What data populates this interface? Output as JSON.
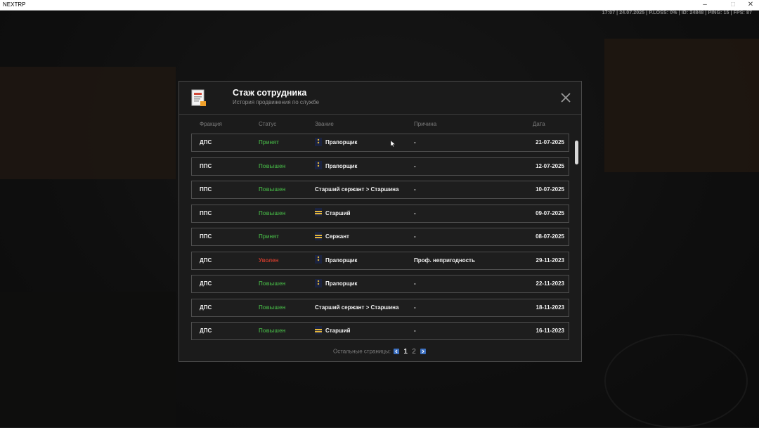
{
  "window": {
    "title": "NEXTRP"
  },
  "hud": {
    "stats": "17:07 | 24.07.2025 | P.LOSS: 0% | ID: 24848 | PING: 15 | FPS: 87"
  },
  "modal": {
    "title": "Стаж сотрудника",
    "subtitle": "История продвижения по службе",
    "columns": {
      "faction": "Фракция",
      "status": "Статус",
      "rank": "Звание",
      "reason": "Причина",
      "date": "Дата"
    },
    "rows": [
      {
        "faction": "ДПС",
        "status": "Принят",
        "rank": "Прапорщик",
        "rank_icon": "ensign-insignia-icon",
        "reason": "-",
        "date": "21-07-2025"
      },
      {
        "faction": "ППС",
        "status": "Повышен",
        "rank": "Прапорщик",
        "rank_icon": "ensign-insignia-icon",
        "reason": "-",
        "date": "12-07-2025"
      },
      {
        "faction": "ППС",
        "status": "Повышен",
        "rank": "Старший сержант > Старшина",
        "rank_icon": "",
        "reason": "-",
        "date": "10-07-2025"
      },
      {
        "faction": "ППС",
        "status": "Повышен",
        "rank": "Старший",
        "rank_icon": "stripes-insignia-icon",
        "reason": "-",
        "date": "09-07-2025"
      },
      {
        "faction": "ППС",
        "status": "Принят",
        "rank": "Сержант",
        "rank_icon": "stripes-insignia-icon",
        "reason": "-",
        "date": "08-07-2025"
      },
      {
        "faction": "ДПС",
        "status": "Уволен",
        "rank": "Прапорщик",
        "rank_icon": "ensign-insignia-icon",
        "reason": "Проф. непригодность",
        "date": "29-11-2023"
      },
      {
        "faction": "ДПС",
        "status": "Повышен",
        "rank": "Прапорщик",
        "rank_icon": "ensign-insignia-icon",
        "reason": "-",
        "date": "22-11-2023"
      },
      {
        "faction": "ДПС",
        "status": "Повышен",
        "rank": "Старший сержант > Старшина",
        "rank_icon": "",
        "reason": "-",
        "date": "18-11-2023"
      },
      {
        "faction": "ДПС",
        "status": "Повышен",
        "rank": "Старший",
        "rank_icon": "stripes-insignia-icon",
        "reason": "-",
        "date": "16-11-2023"
      }
    ],
    "pager": {
      "label": "Остальные страницы:",
      "pages": [
        "1",
        "2"
      ],
      "current": "1"
    }
  },
  "colors": {
    "status_hired": "#3f9b3f",
    "status_promoted": "#3f9b3f",
    "status_fired": "#c0392b",
    "accent": "#3c6fbf"
  }
}
